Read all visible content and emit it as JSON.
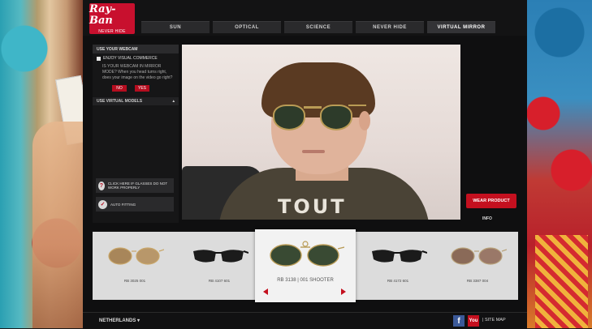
{
  "brand": {
    "name": "Ray-Ban",
    "tagline": "NEVER HIDE"
  },
  "nav": {
    "tabs": [
      "SUN",
      "OPTICAL",
      "SCIENCE",
      "NEVER HIDE",
      "VIRTUAL MIRROR"
    ],
    "active": "VIRTUAL MIRROR"
  },
  "side": {
    "webcam_header": "USE YOUR WEBCAM",
    "checkbox_label": "ENJOY VISUAL COMMERCE",
    "question": "IS YOUR WEBCAM IN MIRROR MODE? When you head turns right, does your image on the video go right?",
    "no": "NO",
    "yes": "YES",
    "virtual_models": "USE VIRTUAL MODELS",
    "help_button": "CLICK HERE IF GLASSES DO NOT WORK PROPERLY",
    "auto_fitting": "AUTO FITTING"
  },
  "wear_button": "WEAR PRODUCT",
  "info": "INFO",
  "products": [
    {
      "label": "RB 3025 001"
    },
    {
      "label": "RB 4107 601"
    },
    {
      "label": "RB 3138 | 001 SHOOTER"
    },
    {
      "label": "RB 4172 601"
    },
    {
      "label": "RB 3387 004"
    }
  ],
  "footer": {
    "country": "NETHERLANDS ▾",
    "facebook": "f",
    "youtube": "You",
    "sitemap": "| SITE MAP"
  },
  "colors": {
    "accent": "#c4101f",
    "panel": "#0f0f10",
    "carousel": "#dcdcdc"
  }
}
